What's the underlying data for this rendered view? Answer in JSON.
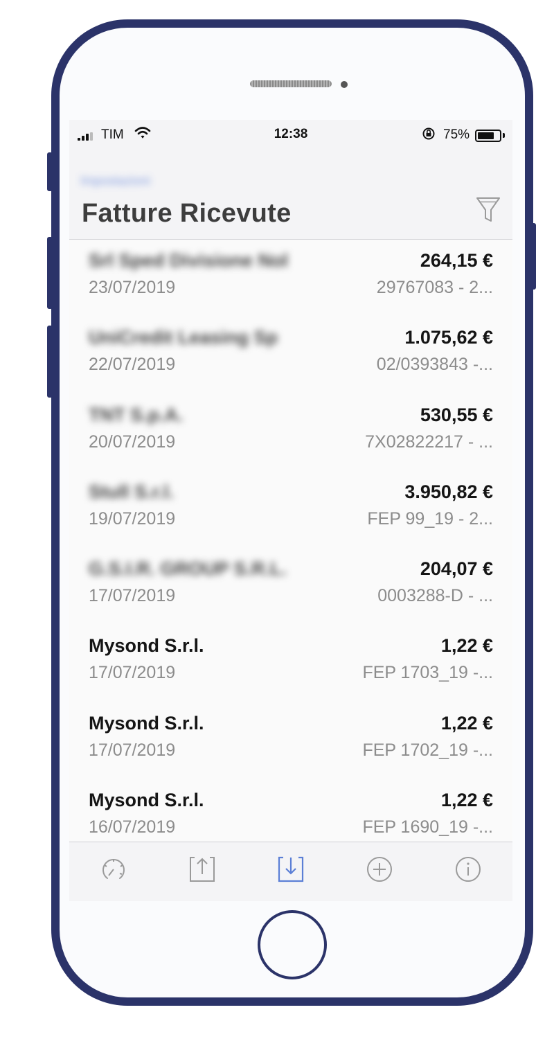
{
  "status_bar": {
    "carrier": "TIM",
    "time": "12:38",
    "battery_percent": "75%",
    "battery_level": 0.75,
    "icons": [
      "signal-icon",
      "wifi-icon",
      "orientation-lock-icon",
      "battery-icon"
    ]
  },
  "header": {
    "back_label": "Impostazioni",
    "title": "Fatture Ricevute",
    "filter_icon": "filter-icon"
  },
  "invoices": [
    {
      "supplier": "Srl Sped Divisione Nol",
      "amount": "264,15 €",
      "date": "23/07/2019",
      "ref": "29767083 - 2...",
      "supplier_blurred": true
    },
    {
      "supplier": "UniCredit Leasing Sp",
      "amount": "1.075,62 €",
      "date": "22/07/2019",
      "ref": "02/0393843 -...",
      "supplier_blurred": true
    },
    {
      "supplier": "TNT S.p.A.",
      "amount": "530,55 €",
      "date": "20/07/2019",
      "ref": "7X02822217 - ...",
      "supplier_blurred": true
    },
    {
      "supplier": "Stull S.r.l.",
      "amount": "3.950,82 €",
      "date": "19/07/2019",
      "ref": "FEP 99_19 - 2...",
      "supplier_blurred": true
    },
    {
      "supplier": "G.S.I.R. GROUP S.R.L.",
      "amount": "204,07 €",
      "date": "17/07/2019",
      "ref": "0003288-D - ...",
      "supplier_blurred": true
    },
    {
      "supplier": "Mysond S.r.l.",
      "amount": "1,22 €",
      "date": "17/07/2019",
      "ref": "FEP 1703_19 -...",
      "supplier_blurred": false
    },
    {
      "supplier": "Mysond S.r.l.",
      "amount": "1,22 €",
      "date": "17/07/2019",
      "ref": "FEP 1702_19 -...",
      "supplier_blurred": false
    },
    {
      "supplier": "Mysond S.r.l.",
      "amount": "1,22 €",
      "date": "16/07/2019",
      "ref": "FEP 1690_19 -...",
      "supplier_blurred": false
    }
  ],
  "tab_bar": {
    "tabs": [
      {
        "icon": "dashboard-icon",
        "active": false
      },
      {
        "icon": "upload-icon",
        "active": false
      },
      {
        "icon": "download-icon",
        "active": true
      },
      {
        "icon": "add-icon",
        "active": false
      },
      {
        "icon": "info-icon",
        "active": false
      }
    ],
    "active_color": "#5b7fd6",
    "inactive_color": "#9a9a9a"
  },
  "device": {
    "frame_color": "#2b3369"
  }
}
